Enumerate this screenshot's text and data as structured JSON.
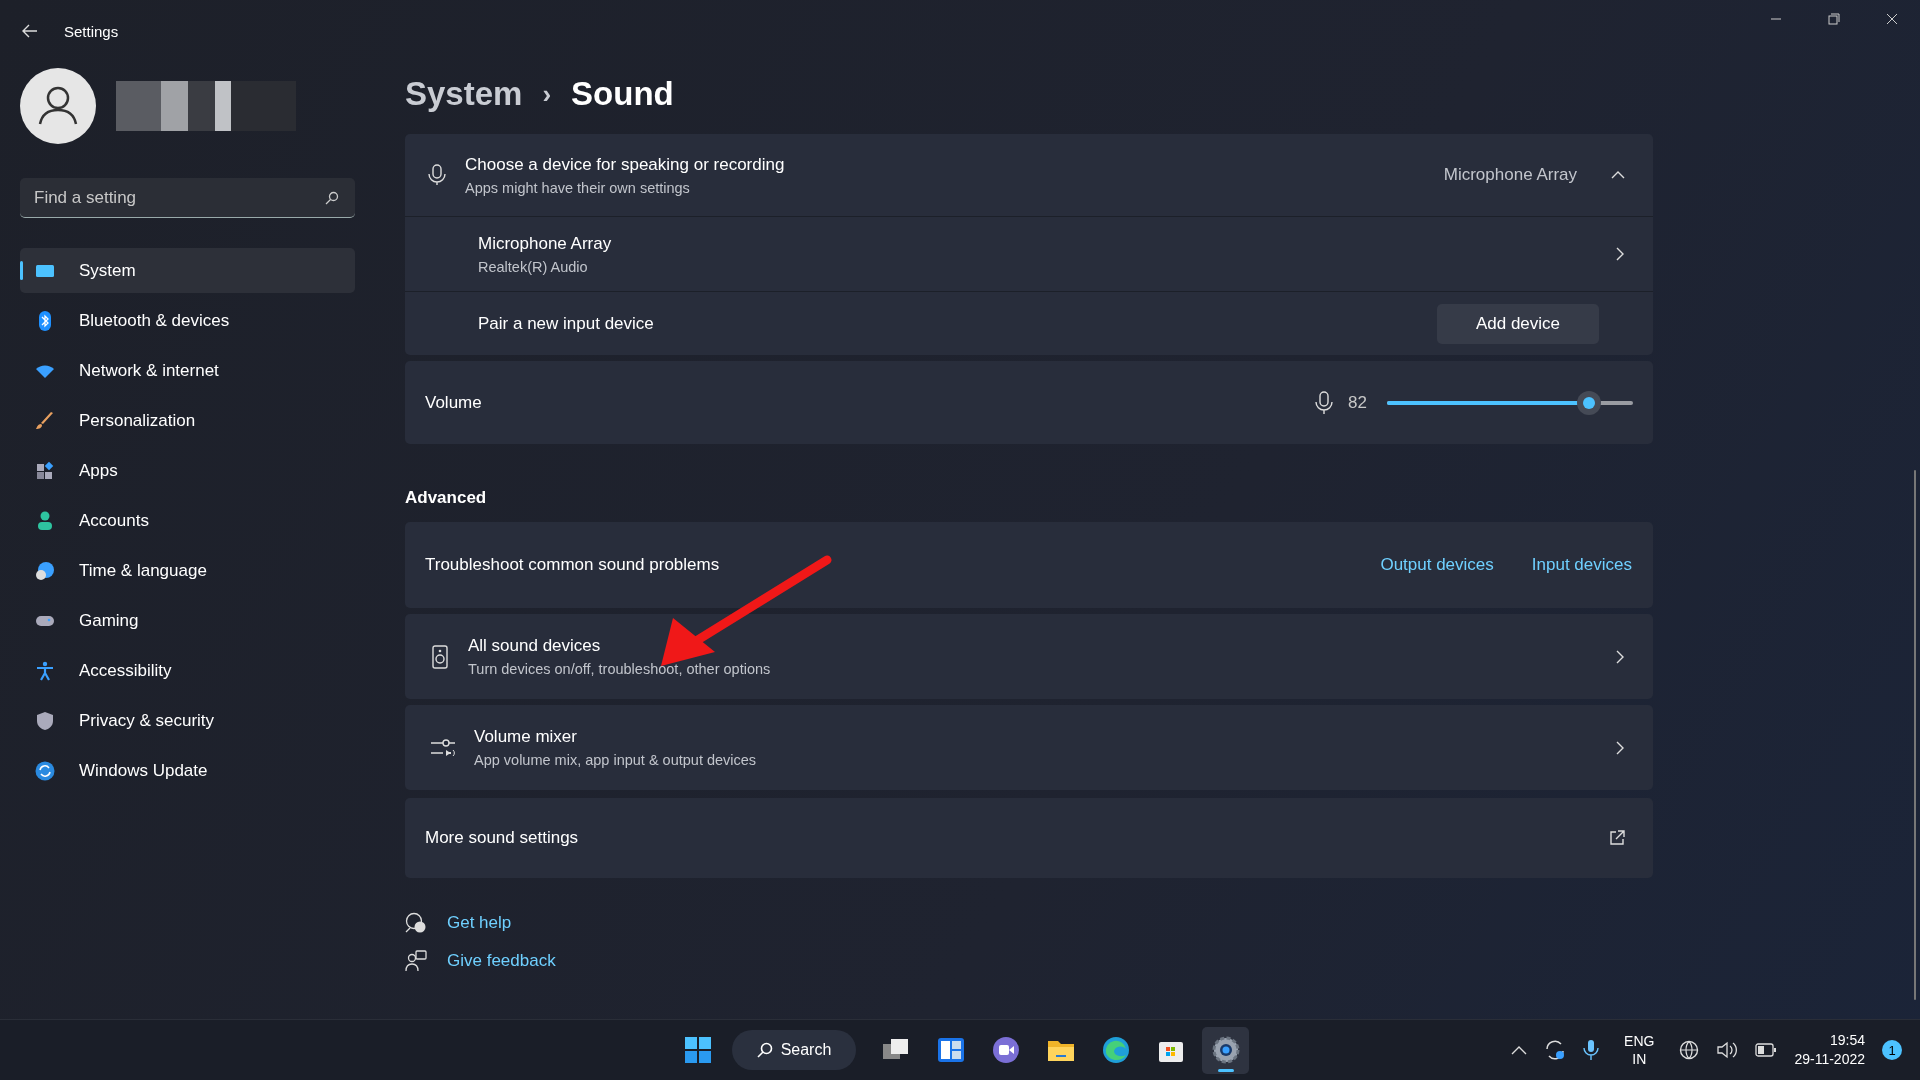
{
  "window": {
    "title": "Settings"
  },
  "sidebar": {
    "search": {
      "placeholder": "Find a setting"
    },
    "items": [
      {
        "label": "System",
        "selected": true
      },
      {
        "label": "Bluetooth & devices",
        "selected": false
      },
      {
        "label": "Network & internet",
        "selected": false
      },
      {
        "label": "Personalization",
        "selected": false
      },
      {
        "label": "Apps",
        "selected": false
      },
      {
        "label": "Accounts",
        "selected": false
      },
      {
        "label": "Time & language",
        "selected": false
      },
      {
        "label": "Gaming",
        "selected": false
      },
      {
        "label": "Accessibility",
        "selected": false
      },
      {
        "label": "Privacy & security",
        "selected": false
      },
      {
        "label": "Windows Update",
        "selected": false
      }
    ]
  },
  "breadcrumb": {
    "parent": "System",
    "separator": "›",
    "current": "Sound"
  },
  "input_card": {
    "title": "Choose a device for speaking or recording",
    "subtitle": "Apps might have their own settings",
    "value": "Microphone Array",
    "expanded": true,
    "device": {
      "name": "Microphone Array",
      "driver": "Realtek(R) Audio"
    },
    "pair": {
      "label": "Pair a new input device",
      "button": "Add device"
    }
  },
  "volume": {
    "label": "Volume",
    "reading": "82",
    "level": 0.82
  },
  "advanced": {
    "heading": "Advanced",
    "troubleshoot": {
      "label": "Troubleshoot common sound problems",
      "links": [
        "Output devices",
        "Input devices"
      ]
    },
    "rows": [
      {
        "kind": "nav",
        "title": "All sound devices",
        "subtitle": "Turn devices on/off, troubleshoot, other options"
      },
      {
        "kind": "nav",
        "title": "Volume mixer",
        "subtitle": "App volume mix, app input & output devices"
      },
      {
        "kind": "external",
        "title": "More sound settings"
      }
    ]
  },
  "help_links": [
    "Get help",
    "Give feedback"
  ],
  "taskbar": {
    "search": "Search",
    "apps": [
      {
        "selected": false
      },
      {
        "selected": false
      },
      {
        "selected": false
      },
      {
        "selected": false
      },
      {
        "selected": false
      },
      {
        "selected": false
      },
      {
        "selected": true
      }
    ],
    "language": [
      "ENG",
      "IN"
    ],
    "time": "19:54",
    "date": "29-11-2022",
    "notifications": "1"
  }
}
